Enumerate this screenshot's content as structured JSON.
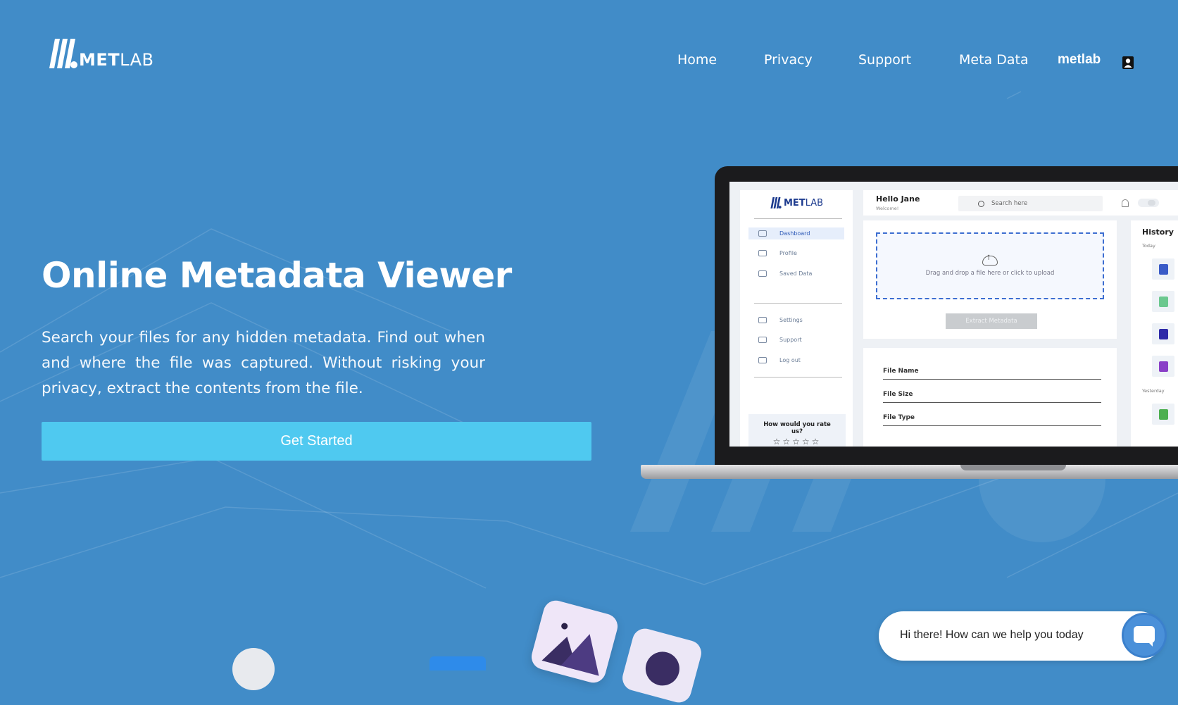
{
  "brand": {
    "logo_bold": "MET",
    "logo_light": "LAB"
  },
  "nav": {
    "items": [
      "Home",
      "Privacy",
      "Support",
      "Meta Data"
    ],
    "user": "metlab"
  },
  "hero": {
    "title": "Online Metadata Viewer",
    "description": "Search your files for any hidden metadata. Find out when and where the file was captured. Without risking your privacy, extract the contents from the file.",
    "cta": "Get Started"
  },
  "app_preview": {
    "logo_bold": "MET",
    "logo_light": "LAB",
    "greeting": "Hello Jane",
    "welcome": "Welcome!",
    "search_placeholder": "Search here",
    "sidebar": [
      "Dashboard",
      "Profile",
      "Saved Data",
      "Settings",
      "Support",
      "Log out"
    ],
    "rate_prompt": "How would you rate us?",
    "stars": "☆☆☆☆☆",
    "upload_hint": "Drag and drop a file here or click to upload",
    "extract_button": "Extract Metadata",
    "fields": [
      "File Name",
      "File Size",
      "File Type"
    ],
    "history": {
      "title": "History",
      "today": "Today",
      "yesterday": "Yesterday"
    }
  },
  "chat": {
    "message": "Hi there! How can we help you today"
  },
  "colors": {
    "background": "#418cc8",
    "cta": "#4fc9f0",
    "accent": "#1c3a8e"
  }
}
